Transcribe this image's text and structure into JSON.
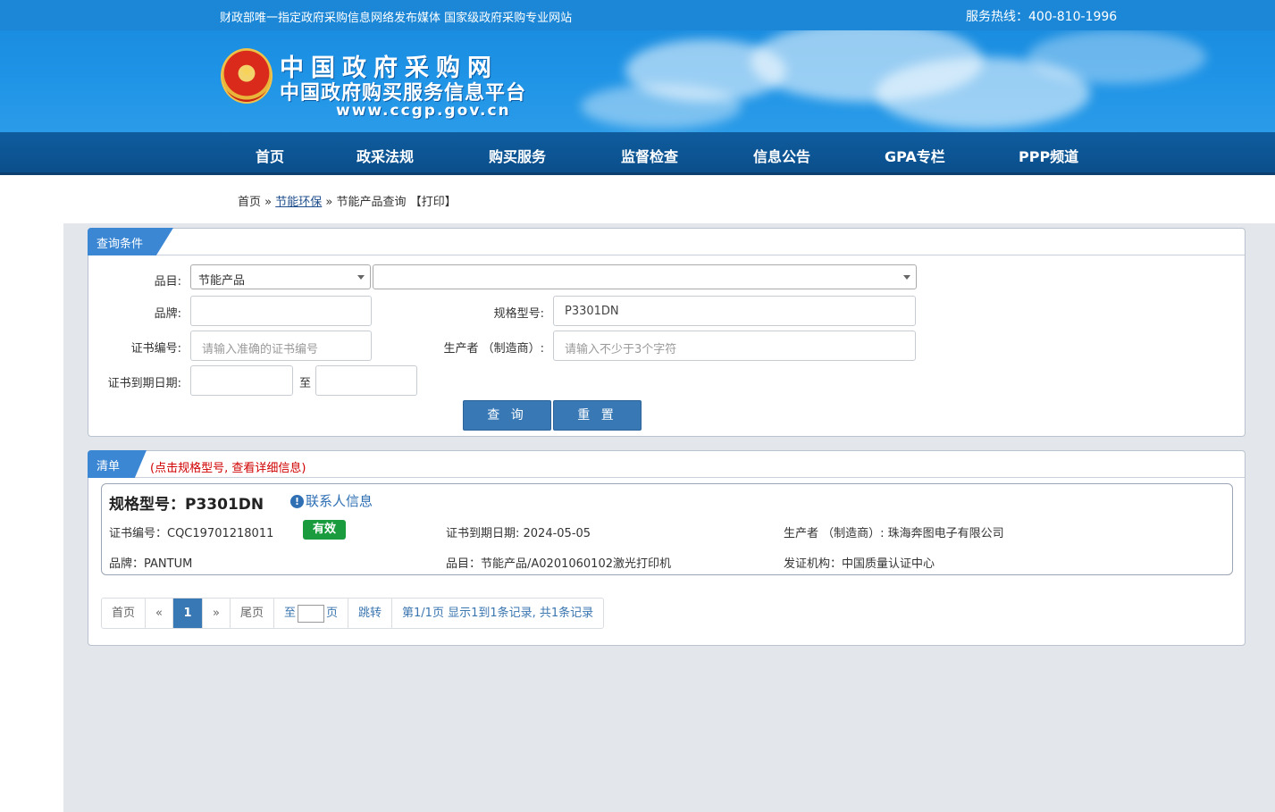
{
  "header": {
    "slogan": "财政部唯一指定政府采购信息网络发布媒体 国家级政府采购专业网站",
    "hotline": "服务热线：400-810-1996",
    "logo_title": "中国政府采购网",
    "logo_subtitle": "中国政府购买服务信息平台",
    "logo_url": "www.ccgp.gov.cn"
  },
  "nav": {
    "items": [
      "首页",
      "政采法规",
      "购买服务",
      "监督检查",
      "信息公告",
      "GPA专栏",
      "PPP频道"
    ]
  },
  "breadcrumb": {
    "home": "首页",
    "sep1": "»",
    "section": "节能环保",
    "sep2": "»",
    "current": "节能产品查询",
    "print": "【打印】"
  },
  "query": {
    "tab": "查询条件",
    "category_label": "品目:",
    "category_value": "节能产品",
    "subcategory_value": "",
    "brand_label": "品牌:",
    "brand_value": "",
    "model_label": "规格型号:",
    "model_value": "P3301DN",
    "cert_label": "证书编号:",
    "cert_placeholder": "请输入准确的证书编号",
    "producer_label": "生产者 （制造商）:",
    "producer_placeholder": "请输入不少于3个字符",
    "expire_label": "证书到期日期:",
    "to_label": "至",
    "search_button": "查 询",
    "reset_button": "重 置"
  },
  "results": {
    "tab": "清单",
    "note": "(点击规格型号, 查看详细信息)",
    "items": [
      {
        "title": "规格型号：P3301DN",
        "contact": "联系人信息",
        "cert_no": "证书编号：CQC19701218011",
        "status": "有效",
        "expire": "证书到期日期: 2024-05-05",
        "producer": "生产者 （制造商）: 珠海奔图电子有限公司",
        "brand": "品牌：PANTUM",
        "category": "品目：节能产品/A0201060102激光打印机",
        "issuer": "发证机构：中国质量认证中心"
      }
    ]
  },
  "pager": {
    "first": "首页",
    "prev": "«",
    "current": "1",
    "next": "»",
    "last": "尾页",
    "goto_prefix": "至",
    "goto_suffix": "页",
    "jump": "跳转",
    "summary": "第1/1页  显示1到1条记录, 共1条记录"
  }
}
